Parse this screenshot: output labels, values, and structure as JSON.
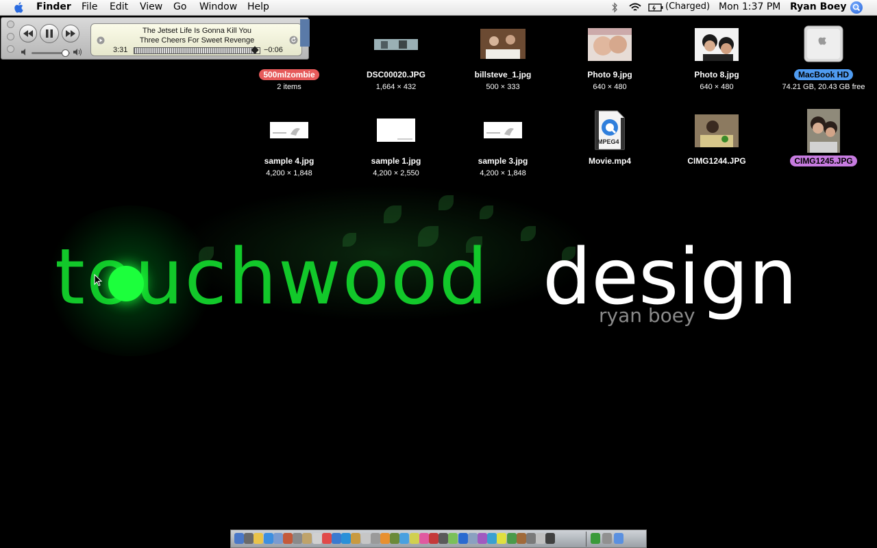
{
  "menubar": {
    "app_name": "Finder",
    "menus": [
      "File",
      "Edit",
      "View",
      "Go",
      "Window",
      "Help"
    ],
    "battery_status": "(Charged)",
    "clock": "Mon 1:37 PM",
    "user": "Ryan Boey",
    "icons": [
      "apple-icon",
      "bluetooth-icon",
      "wifi-icon",
      "battery-icon",
      "spotlight-icon"
    ]
  },
  "mini_player": {
    "track_title": "The Jetset Life Is Gonna Kill You",
    "artist": "Three Cheers For Sweet Revenge",
    "elapsed": "3:31",
    "remaining": "−0:06",
    "progress_fraction": 0.97,
    "volume_fraction": 0.85,
    "controls": [
      "previous-icon",
      "pause-icon",
      "next-icon"
    ]
  },
  "desktop": {
    "icons": [
      {
        "name": "500mlzombie",
        "meta": "2 items",
        "label_color": "#e65a5a",
        "kind": "folder"
      },
      {
        "name": "DSC00020.JPG",
        "meta": "1,664 × 432",
        "label_color": "",
        "kind": "image"
      },
      {
        "name": "billsteve_1.jpg",
        "meta": "500 × 333",
        "label_color": "",
        "kind": "image"
      },
      {
        "name": "Photo 9.jpg",
        "meta": "640 × 480",
        "label_color": "",
        "kind": "image"
      },
      {
        "name": "Photo 8.jpg",
        "meta": "640 × 480",
        "label_color": "",
        "kind": "image"
      },
      {
        "name": "MacBook HD",
        "meta": "74.21 GB, 20.43 GB free",
        "label_color": "#4f9bf0",
        "kind": "drive"
      },
      {
        "name": "sample 4.jpg",
        "meta": "4,200 × 1,848",
        "label_color": "",
        "kind": "image"
      },
      {
        "name": "sample 1.jpg",
        "meta": "4,200 × 2,550",
        "label_color": "",
        "kind": "image"
      },
      {
        "name": "sample 3.jpg",
        "meta": "4,200 × 1,848",
        "label_color": "",
        "kind": "image"
      },
      {
        "name": "Movie.mp4",
        "meta": "",
        "label_color": "",
        "kind": "movie"
      },
      {
        "name": "CIMG1244.JPG",
        "meta": "",
        "label_color": "",
        "kind": "image"
      },
      {
        "name": "CIMG1245.JPG",
        "meta": "",
        "label_color": "#c77be0",
        "kind": "image"
      }
    ]
  },
  "wallpaper": {
    "brand_green": "touchwood",
    "brand_white": "design",
    "byline": "ryan boey",
    "accent_color": "#12c82a"
  },
  "movie_badge": "MPEG4"
}
